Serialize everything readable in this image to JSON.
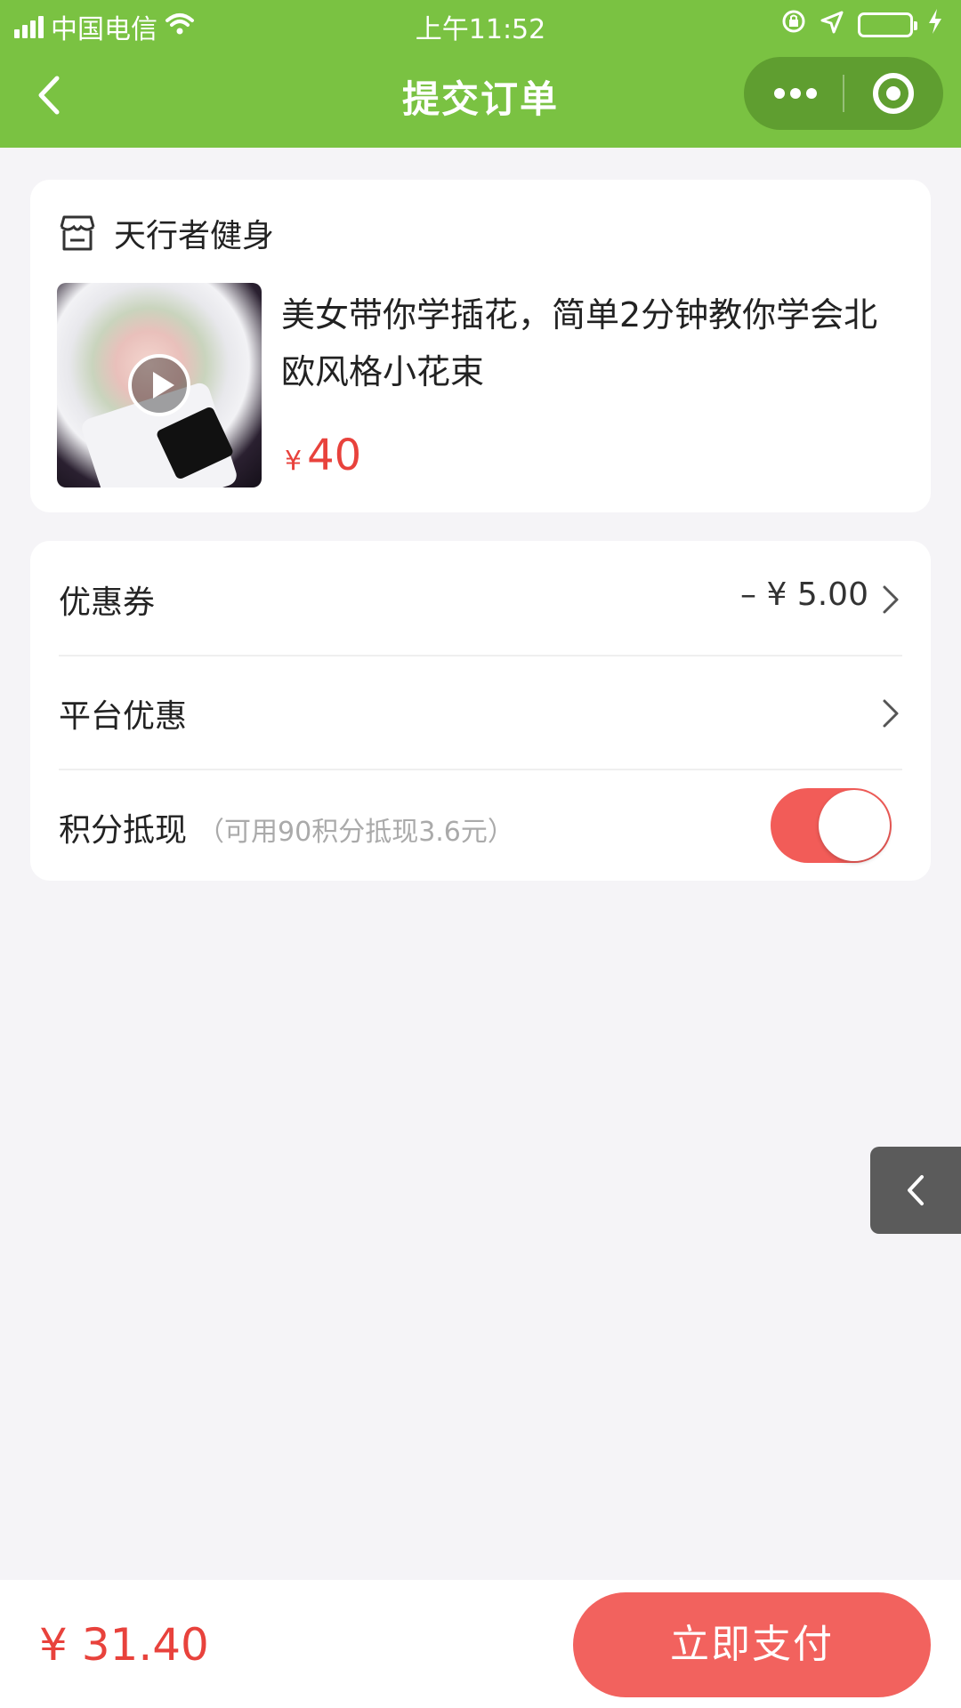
{
  "status_bar": {
    "carrier": "中国电信",
    "time": "上午11:52"
  },
  "nav": {
    "title": "提交订单"
  },
  "shop": {
    "name": "天行者健身",
    "product": {
      "title": "美女带你学插花，简单2分钟教你学会北欧风格小花束",
      "currency": "¥",
      "price": "40"
    }
  },
  "discounts": {
    "coupon": {
      "label": "优惠券",
      "value": "– ¥ 5.00"
    },
    "platform": {
      "label": "平台优惠"
    },
    "points": {
      "label": "积分抵现",
      "hint": "（可用90积分抵现3.6元）",
      "enabled": true
    }
  },
  "footer": {
    "total": "¥ 31.40",
    "pay_label": "立即支付"
  },
  "colors": {
    "header_green": "#7ac242",
    "price_red": "#e8423c",
    "button_red": "#f2625e"
  },
  "icons": [
    "signal-icon",
    "wifi-icon",
    "lock-icon",
    "location-icon",
    "battery-icon",
    "charging-icon",
    "back-icon",
    "more-icon",
    "close-capsule-icon",
    "store-icon",
    "play-icon",
    "chevron-right-icon",
    "chevron-left-icon"
  ]
}
